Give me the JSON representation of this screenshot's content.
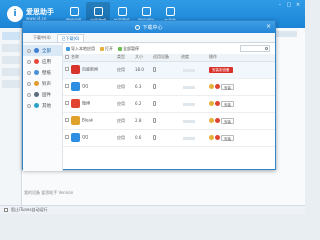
{
  "header": {
    "brand": "爱思助手",
    "brand_sub": "www.i4.cn",
    "nav": [
      {
        "label": "我的设备"
      },
      {
        "label": "应用游戏"
      },
      {
        "label": "铃声壁纸"
      },
      {
        "label": "刷机越狱"
      },
      {
        "label": "工具箱"
      }
    ]
  },
  "bg": {
    "tabs": [
      "下载中(4)",
      "已下载(6)"
    ],
    "footer_text": "我的设备 爱思助手 Version"
  },
  "statusbar": {
    "text": "阻止iTunes自动运行"
  },
  "dialog": {
    "title": "下载中心",
    "close": "×",
    "tabs": [
      "下载中(4)",
      "已下载(6)"
    ],
    "categories": [
      {
        "label": "全部",
        "color": "#3f7fd1"
      },
      {
        "label": "应用",
        "color": "#e44b3a"
      },
      {
        "label": "壁纸",
        "color": "#4a90d9"
      },
      {
        "label": "铃声",
        "color": "#e59a2b"
      },
      {
        "label": "固件",
        "color": "#5a6c7d"
      },
      {
        "label": "其他",
        "color": "#2aa2c7"
      }
    ],
    "toolbar": [
      "导入本地应用",
      "打开",
      "全部暂停"
    ],
    "search_placeholder": "",
    "columns": [
      "名称",
      "类型",
      "大小",
      "适用设备",
      "进度",
      "操作"
    ],
    "rows": [
      {
        "name": "百度新闻",
        "type": "应用",
        "size": "18.0",
        "action": "安装到设备",
        "icon_color": "#d9342b",
        "highlight": true,
        "action_type": "primary"
      },
      {
        "name": "QQ",
        "type": "应用",
        "size": "6.3",
        "action": "安装",
        "icon_color": "#2b8ee0",
        "highlight": false,
        "action_type": "normal"
      },
      {
        "name": "微博",
        "type": "应用",
        "size": "6.2",
        "action": "安装",
        "icon_color": "#e2432f",
        "highlight": false,
        "action_type": "normal"
      },
      {
        "name": "Bleak",
        "type": "应用",
        "size": "2.8",
        "action": "安装",
        "icon_color": "#e0a12a",
        "highlight": false,
        "action_type": "normal"
      },
      {
        "name": "QQ",
        "type": "应用",
        "size": "0.6",
        "action": "安装",
        "icon_color": "#2b8ee0",
        "highlight": false,
        "action_type": "normal"
      }
    ]
  }
}
